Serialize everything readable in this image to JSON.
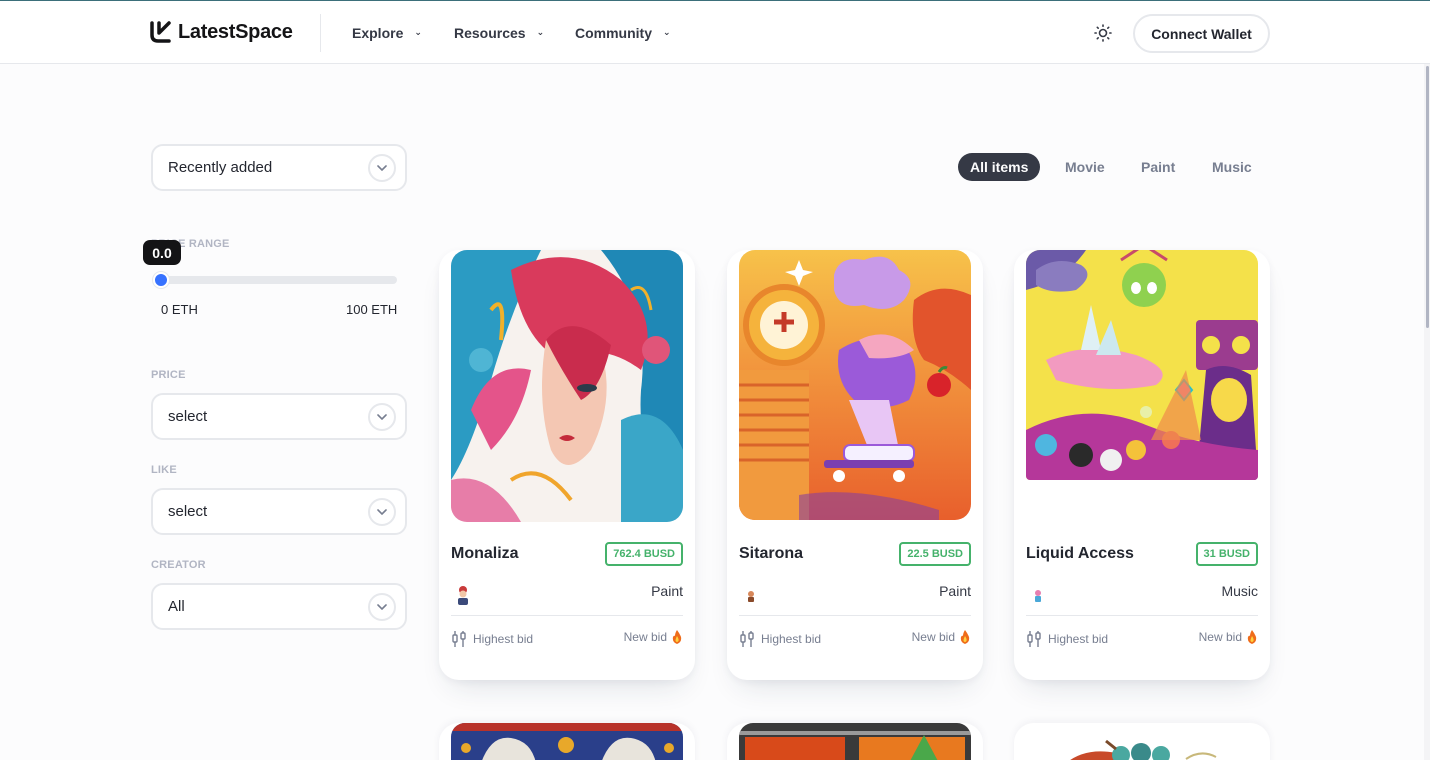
{
  "header": {
    "brand": "LatestSpace",
    "nav": [
      {
        "label": "Explore"
      },
      {
        "label": "Resources"
      },
      {
        "label": "Community"
      }
    ],
    "wallet_button": "Connect Wallet"
  },
  "sidebar": {
    "sort_select": "Recently added",
    "range_label": "PRICE RANGE",
    "range_value": "0.0",
    "range_value_fraction": 0.0,
    "range_min": "0 ETH",
    "range_max": "100 ETH",
    "filters": [
      {
        "label": "PRICE",
        "value": "select"
      },
      {
        "label": "LIKE",
        "value": "select"
      },
      {
        "label": "CREATOR",
        "value": "All"
      }
    ]
  },
  "tabs": [
    {
      "label": "All items",
      "active": true
    },
    {
      "label": "Movie",
      "active": false
    },
    {
      "label": "Paint",
      "active": false
    },
    {
      "label": "Music",
      "active": false
    }
  ],
  "cards": [
    {
      "title": "Monaliza",
      "price": "762.4 BUSD",
      "category": "Paint",
      "bid_label": "Highest bid",
      "new_bid": "New bid"
    },
    {
      "title": "Sitarona",
      "price": "22.5 BUSD",
      "category": "Paint",
      "bid_label": "Highest bid",
      "new_bid": "New bid"
    },
    {
      "title": "Liquid Access",
      "price": "31 BUSD",
      "category": "Music",
      "bid_label": "Highest bid",
      "new_bid": "New bid"
    }
  ],
  "colors": {
    "accent": "#3772ff",
    "price_green": "#45b26b",
    "dark": "#353945",
    "muted": "#777e90"
  }
}
